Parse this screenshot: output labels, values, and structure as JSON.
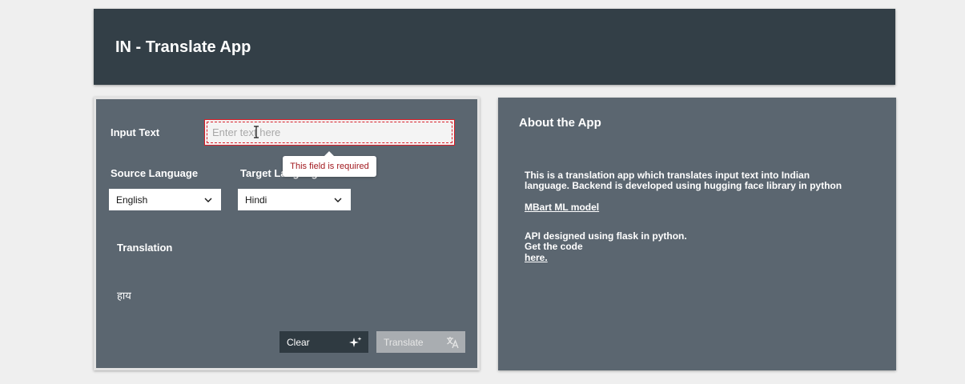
{
  "header": {
    "title": "IN - Translate App"
  },
  "form": {
    "input_label": "Input Text",
    "input_placeholder": "Enter text here",
    "input_value": "",
    "validation_message": "This field is required",
    "source_label": "Source Language",
    "target_label": "Target Language",
    "source_value": "English",
    "target_value": "Hindi",
    "translation_label": "Translation",
    "translation_text": "हाय",
    "clear_label": "Clear",
    "translate_label": "Translate"
  },
  "about": {
    "title": "About the App",
    "line1": "This is a translation app which translates input text into Indian",
    "line2": "language. Backend is developed using hugging face library in python",
    "model_link": "MBart ML model",
    "api_line": "API designed using flask in python.",
    "code_line": "Get the code",
    "code_link": "here."
  },
  "colors": {
    "header_bg": "#333f47",
    "panel_bg": "#5b6670",
    "error": "#da1e28",
    "error_text": "#a2191f",
    "clear_button_bg": "#2f3a41",
    "translate_button_bg": "#a9adb1"
  },
  "icons": {
    "clear": "sparkle-icon",
    "translate": "translate-icon",
    "dropdown": "chevron-down-icon",
    "cursor": "text-cursor-icon"
  }
}
